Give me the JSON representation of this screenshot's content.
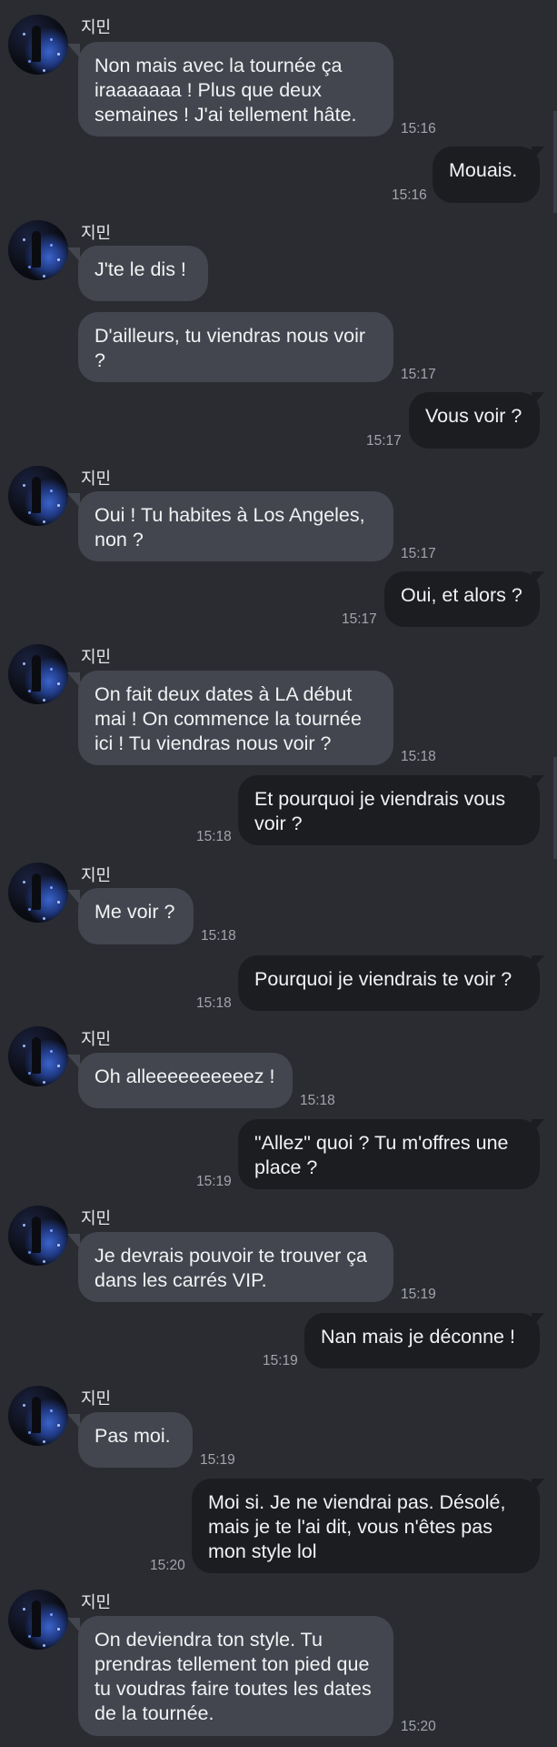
{
  "contact": {
    "name": "지민"
  },
  "messages": [
    {
      "from": "them",
      "text": "Non mais avec la tournée ça iraaaaaaa ! Plus que deux semaines ! J'ai tellement hâte.",
      "time": "15:16"
    },
    {
      "from": "me",
      "text": "Mouais.",
      "time": "15:16"
    },
    {
      "from": "them",
      "text": "J'te le dis !",
      "time": ""
    },
    {
      "from": "them",
      "text": "D'ailleurs, tu viendras nous voir ?",
      "time": "15:17"
    },
    {
      "from": "me",
      "text": "Vous voir ?",
      "time": "15:17"
    },
    {
      "from": "them",
      "text": "Oui ! Tu habites à Los Angeles, non ?",
      "time": "15:17"
    },
    {
      "from": "me",
      "text": "Oui, et alors ?",
      "time": "15:17"
    },
    {
      "from": "them",
      "text": "On fait deux dates à LA début mai ! On commence la tournée ici ! Tu viendras nous voir ?",
      "time": "15:18"
    },
    {
      "from": "me",
      "text": "Et pourquoi je viendrais vous voir ?",
      "time": "15:18"
    },
    {
      "from": "them",
      "text": "Me voir ?",
      "time": "15:18"
    },
    {
      "from": "me",
      "text": "Pourquoi je viendrais te voir ?",
      "time": "15:18"
    },
    {
      "from": "them",
      "text": "Oh alleeeeeeeeeez !",
      "time": "15:18"
    },
    {
      "from": "me",
      "text": "\"Allez\" quoi ? Tu m'offres une place ?",
      "time": "15:19"
    },
    {
      "from": "them",
      "text": "Je devrais pouvoir te trouver ça dans les carrés VIP.",
      "time": "15:19"
    },
    {
      "from": "me",
      "text": "Nan mais je déconne !",
      "time": "15:19"
    },
    {
      "from": "them",
      "text": "Pas moi.",
      "time": "15:19"
    },
    {
      "from": "me",
      "text": "Moi si. Je ne viendrai pas. Désolé, mais je te l'ai dit, vous n'êtes pas mon style lol",
      "time": "15:20"
    },
    {
      "from": "them",
      "text": "On deviendra ton style. Tu prendras tellement ton pied que tu voudras faire toutes les dates de la tournée.",
      "time": "15:20"
    }
  ]
}
